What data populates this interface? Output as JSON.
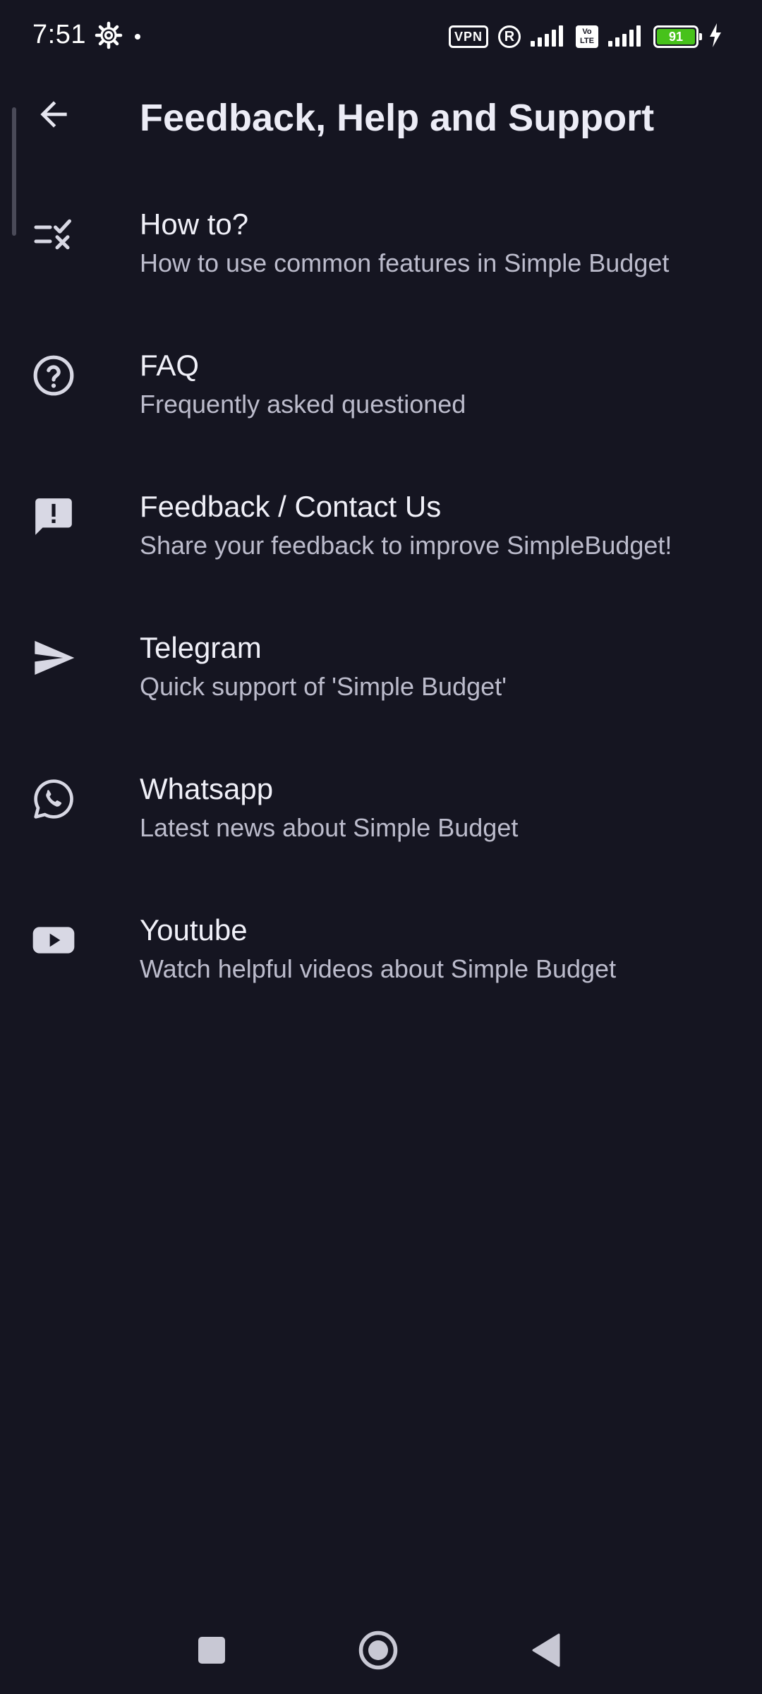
{
  "status_bar": {
    "time": "7:51",
    "vpn_label": "VPN",
    "roaming_label": "R",
    "volte_label_top": "Vo",
    "volte_label_bottom": "LTE",
    "battery_level": "91",
    "battery_color": "#47c21b"
  },
  "app_bar": {
    "title": "Feedback, Help and Support",
    "back_icon": "arrow-back-icon"
  },
  "items": [
    {
      "icon": "checklist-icon",
      "title": "How to?",
      "subtitle": "How to use common features in Simple Budget"
    },
    {
      "icon": "help-circle-icon",
      "title": "FAQ",
      "subtitle": "Frequently asked questioned"
    },
    {
      "icon": "feedback-icon",
      "title": "Feedback / Contact Us",
      "subtitle": "Share your feedback to improve SimpleBudget!"
    },
    {
      "icon": "send-icon",
      "title": "Telegram",
      "subtitle": "Quick support of 'Simple Budget'"
    },
    {
      "icon": "whatsapp-icon",
      "title": "Whatsapp",
      "subtitle": "Latest news about Simple Budget"
    },
    {
      "icon": "youtube-icon",
      "title": "Youtube",
      "subtitle": "Watch helpful videos about Simple Budget"
    }
  ],
  "nav_bar": {
    "recents_icon": "square-icon",
    "home_icon": "circle-icon",
    "back_icon": "triangle-back-icon"
  },
  "colors": {
    "background": "#151521",
    "title_text": "#ececf6",
    "subtitle_text": "#bcbccc",
    "icon": "#d8d8e4"
  }
}
